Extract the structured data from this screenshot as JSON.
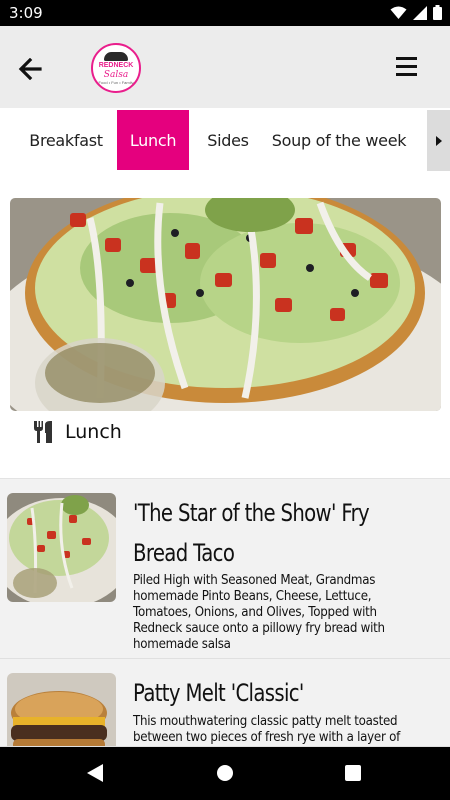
{
  "status": {
    "time": "3:09",
    "icons": [
      "wifi-icon",
      "signal-icon",
      "battery-icon"
    ]
  },
  "header": {
    "logo_line1": "REDNECK",
    "logo_line2": "Salsa",
    "logo_line3": "Food • Fun • Family",
    "back_icon": "arrow-left-icon",
    "menu_icon": "hamburger-menu-icon"
  },
  "tabs": [
    {
      "label": "Breakfast",
      "active": false
    },
    {
      "label": "Lunch",
      "active": true
    },
    {
      "label": "Sides",
      "active": false
    },
    {
      "label": "Soup of the week",
      "active": false
    }
  ],
  "hero": {
    "category_icon": "fork-knife-icon",
    "category": "Lunch"
  },
  "items": [
    {
      "title_line1": "'The Star of the Show' Fry",
      "title_line2": "Bread Taco",
      "description": "Piled High with Seasoned Meat, Grandmas homemade Pinto Beans, Cheese, Lettuce, Tomatoes, Onions, and Olives, Topped with Redneck sauce onto a pillowy fry bread with homemade salsa"
    },
    {
      "title_line1": "Patty Melt 'Classic'",
      "title_line2": "",
      "description": "This mouthwatering classic patty melt toasted between two pieces of fresh rye with a layer of cheese"
    }
  ],
  "colors": {
    "accent": "#e5007e",
    "header_bg": "#ececec",
    "item_bg": "#f2f2f2"
  }
}
